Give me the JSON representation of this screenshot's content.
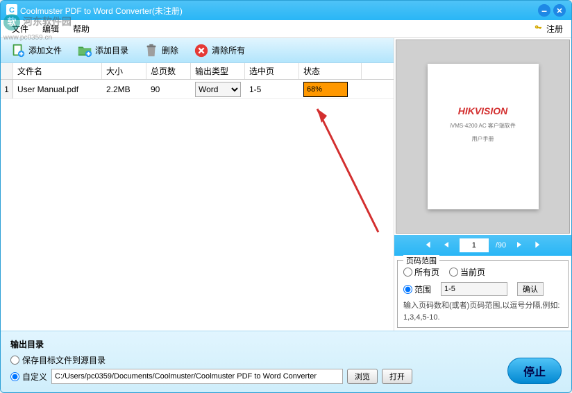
{
  "titlebar": {
    "title": "Coolmuster PDF to Word Converter(未注册)"
  },
  "menu": {
    "file": "文件",
    "edit": "编辑",
    "help": "帮助",
    "register": "注册"
  },
  "watermark": {
    "line1": "河东软件园",
    "line2": "www.pc0359.cn"
  },
  "toolbar": {
    "add_file": "添加文件",
    "add_folder": "添加目录",
    "delete": "删除",
    "clear": "清除所有"
  },
  "table": {
    "headers": {
      "name": "文件名",
      "size": "大小",
      "pages": "总页数",
      "type": "输出类型",
      "sel": "选中页",
      "status": "状态"
    },
    "rows": [
      {
        "idx": "1",
        "name": "User Manual.pdf",
        "size": "2.2MB",
        "pages": "90",
        "type": "Word",
        "sel": "1-5",
        "status": "68%"
      }
    ]
  },
  "preview": {
    "brand": "HIKVISION",
    "subtitle": "iVMS-4200 AC 客户端软件",
    "subtitle2": "用户手册"
  },
  "pager": {
    "current": "1",
    "total": "/90"
  },
  "range": {
    "legend": "页码范围",
    "all": "所有页",
    "current": "当前页",
    "range": "范围",
    "value": "1-5",
    "confirm": "确认",
    "hint1": "输入页码数和(或者)页码范围,以逗号分隔,例如:",
    "hint2": "1,3,4,5-10."
  },
  "output": {
    "title": "输出目录",
    "to_source": "保存目标文件到源目录",
    "custom": "自定义",
    "path": "C:/Users/pc0359/Documents/Coolmuster/Coolmuster PDF to Word Converter",
    "browse": "浏览",
    "open": "打开"
  },
  "action": {
    "stop": "停止"
  }
}
